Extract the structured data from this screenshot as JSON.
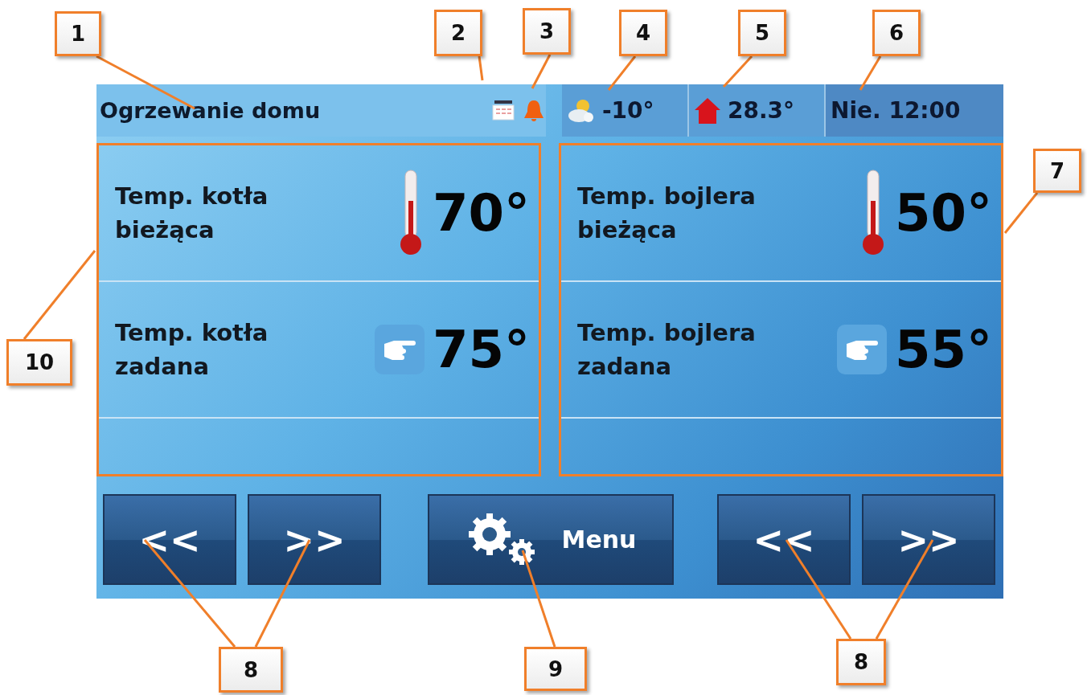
{
  "screen": {
    "header": {
      "title": "Ogrzewanie domu",
      "outside_temp": "-10°",
      "room_temp": "28.3°",
      "datetime": "Nie. 12:00"
    },
    "panels": [
      {
        "rows": [
          {
            "kind": "current",
            "label": "Temp. kotła bieżąca",
            "value": "70°"
          },
          {
            "kind": "set",
            "label": "Temp. kotła zadana",
            "value": "75°"
          }
        ]
      },
      {
        "rows": [
          {
            "kind": "current",
            "label": "Temp. bojlera bieżąca",
            "value": "50°"
          },
          {
            "kind": "set",
            "label": "Temp. bojlera zadana",
            "value": "55°"
          }
        ]
      }
    ],
    "buttons": [
      {
        "kind": "arrow",
        "label": "<<"
      },
      {
        "kind": "arrow",
        "label": ">>"
      },
      {
        "kind": "menu",
        "label": "Menu"
      },
      {
        "kind": "arrow",
        "label": "<<"
      },
      {
        "kind": "arrow",
        "label": ">>"
      }
    ]
  },
  "callouts": [
    {
      "number": "1"
    },
    {
      "number": "2"
    },
    {
      "number": "3"
    },
    {
      "number": "4"
    },
    {
      "number": "5"
    },
    {
      "number": "6"
    },
    {
      "number": "7"
    },
    {
      "number": "10"
    },
    {
      "number": "8"
    },
    {
      "number": "9"
    },
    {
      "number": "8"
    }
  ]
}
